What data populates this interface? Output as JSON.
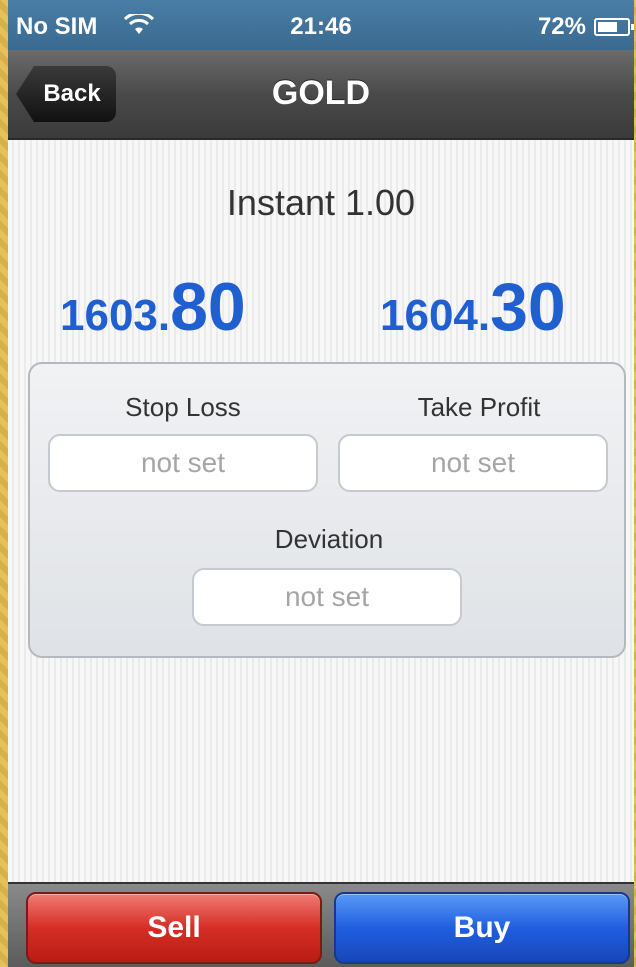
{
  "status_bar": {
    "carrier": "No SIM",
    "time": "21:46",
    "battery": "72%",
    "battery_level": 0.72
  },
  "nav": {
    "back_label": "Back",
    "title": "GOLD"
  },
  "order": {
    "type_text": "Instant 1.00",
    "bid": {
      "small": "1603.",
      "big": "80"
    },
    "ask": {
      "small": "1604.",
      "big": "30"
    }
  },
  "panel": {
    "stop_loss_label": "Stop Loss",
    "stop_loss_value": "not set",
    "take_profit_label": "Take Profit",
    "take_profit_value": "not set",
    "deviation_label": "Deviation",
    "deviation_value": "not set"
  },
  "toolbar": {
    "sell_label": "Sell",
    "buy_label": "Buy"
  },
  "colors": {
    "price_blue": "#1f5fcf",
    "sell_red": "#d52e25",
    "buy_blue": "#1f5fe0"
  },
  "icons": [
    "wifi-icon",
    "battery-icon",
    "back-arrow-icon"
  ]
}
